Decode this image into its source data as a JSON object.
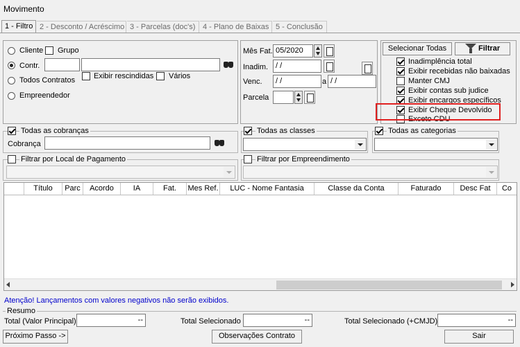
{
  "window": {
    "title": "Movimento"
  },
  "tabs": [
    {
      "label": "1 - Filtro"
    },
    {
      "label": "2 - Desconto / Acréscimo"
    },
    {
      "label": "3 - Parcelas (doc's)"
    },
    {
      "label": "4 - Plano de Baixas"
    },
    {
      "label": "5 - Conclusão"
    }
  ],
  "client_panel": {
    "cliente": "Cliente",
    "grupo": "Grupo",
    "contr": "Contr.",
    "exibir_rescindidas": "Exibir rescindidas",
    "varios": "Vários",
    "todos_contratos": "Todos Contratos",
    "empreendedor": "Empreendedor",
    "contr_value": "",
    "contr_name_value": ""
  },
  "date_panel": {
    "mes_fat_label": "Mês Fat.",
    "mes_fat_value": "05/2020",
    "inadim_label": "Inadim.",
    "inadim_value": " /  /",
    "venc_label": "Venc.",
    "venc_from": " /  /",
    "venc_sep": "a",
    "venc_to": " /  /",
    "parcela_label": "Parcela",
    "parcela_value": ""
  },
  "right_panel": {
    "select_all": "Selecionar Todas",
    "filtrar": "Filtrar",
    "options": [
      {
        "label": "Inadimplência total",
        "checked": true
      },
      {
        "label": "Exibir recebidas não baixadas",
        "checked": true
      },
      {
        "label": "Manter CMJ",
        "checked": false
      },
      {
        "label": "Exibir contas sub judice",
        "checked": true
      },
      {
        "label": "Exibir encargos específicos",
        "checked": true
      },
      {
        "label": "Exibir Cheque Devolvido",
        "checked": true
      },
      {
        "label": "Exceto CDU",
        "checked": false
      }
    ]
  },
  "cobranca": {
    "todas_label": "Todas as cobranças",
    "cobranca_label": "Cobrança",
    "value": ""
  },
  "classes": {
    "todas_label": "Todas as classes",
    "value": ""
  },
  "categorias": {
    "todas_label": "Todas as categorias",
    "value": ""
  },
  "local_pagamento": {
    "label": "Filtrar por Local de Pagamento",
    "value": ""
  },
  "empreendimento": {
    "label": "Filtrar por Empreendimento",
    "value": ""
  },
  "grid": {
    "columns": [
      "Título",
      "Parc",
      "Acordo",
      "IA",
      "Fat.",
      "Mes Ref.",
      "LUC - Nome Fantasia",
      "Classe da Conta",
      "Faturado",
      "Desc Fat",
      "Co"
    ]
  },
  "warning": "Atenção! Lançamentos com valores negativos não serão exibidos.",
  "resumo": {
    "title": "Resumo",
    "total_principal_label": "Total (Valor Principal)",
    "total_principal_value": "--",
    "total_selecionado_label": "Total Selecionado",
    "total_selecionado_value": "--",
    "total_cmjd_label": "Total Selecionado (+CMJD)",
    "total_cmjd_value": "--"
  },
  "footer": {
    "proximo": "Próximo Passo ->",
    "observacoes": "Observações Contrato",
    "sair": "Sair"
  },
  "colors": {
    "highlight": "#e02020",
    "warning_text": "#0000cc"
  }
}
